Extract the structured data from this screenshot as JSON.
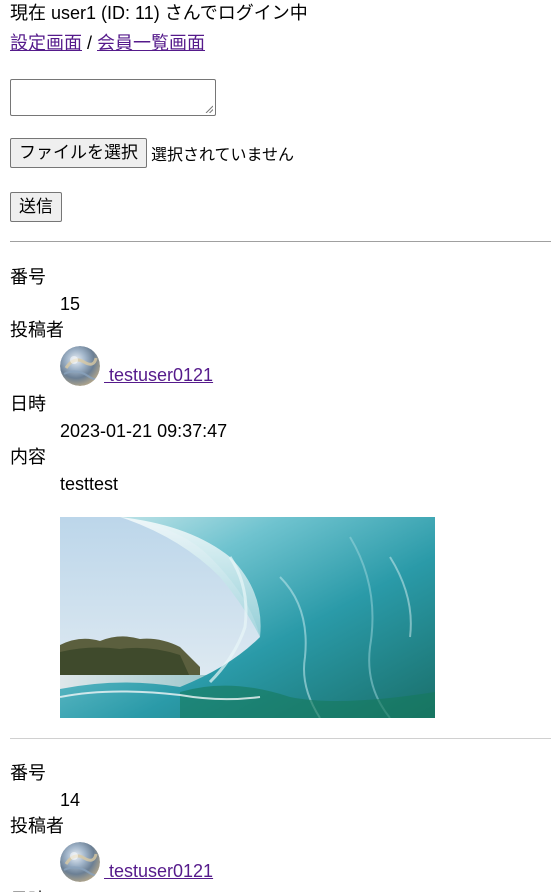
{
  "header": {
    "status_text": "現在 user1 (ID: 11) さんでログイン中",
    "settings_link": "設定画面",
    "link_separator": " / ",
    "members_link": "会員一覧画面"
  },
  "form": {
    "textarea_value": "",
    "file_button_label": "ファイルを選択",
    "file_status": "選択されていません",
    "submit_label": "送信"
  },
  "labels": {
    "number": "番号",
    "author": "投稿者",
    "datetime": "日時",
    "content": "内容"
  },
  "posts": [
    {
      "number": "15",
      "author": " testuser0121",
      "datetime": "2023-01-21 09:37:47",
      "content": "testtest",
      "image_icon": "ocean-wave-photo"
    },
    {
      "number": "14",
      "author": " testuser0121"
    }
  ],
  "colors": {
    "link": "#551a8b",
    "separator": "#a0a0a0"
  }
}
